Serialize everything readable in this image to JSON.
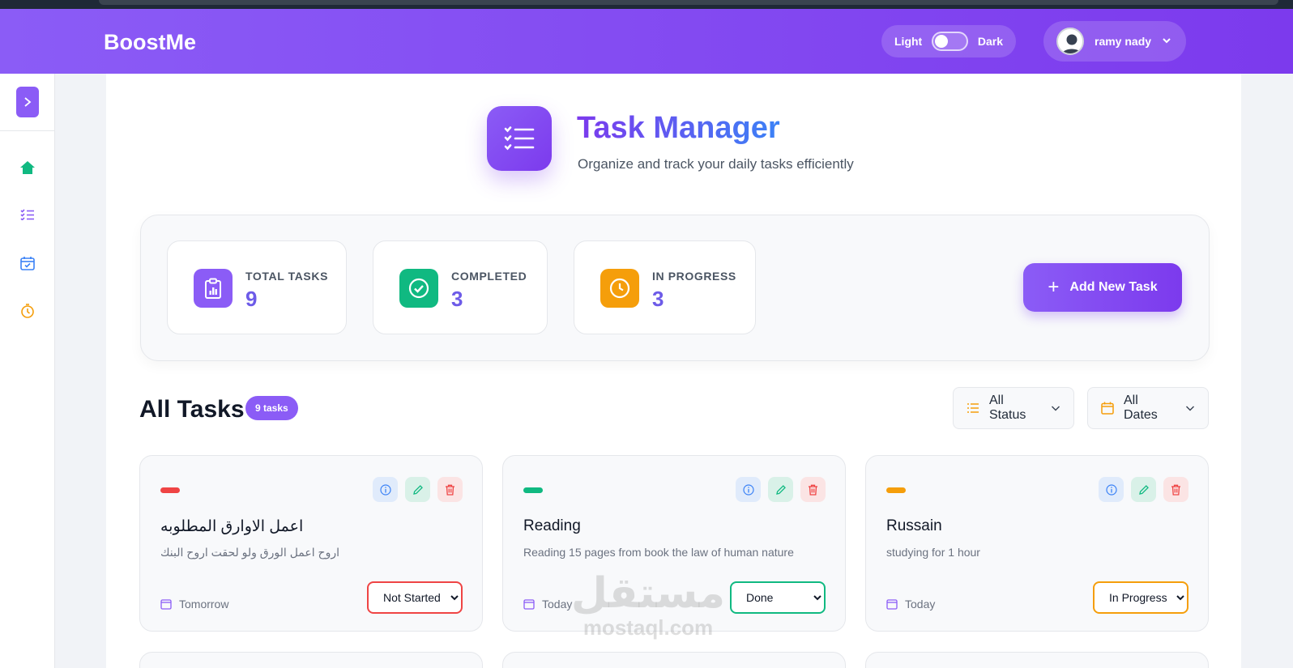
{
  "navbar": {
    "brand": "BoostMe",
    "theme_light_label": "Light",
    "theme_dark_label": "Dark",
    "user_name": "ramy nady"
  },
  "sidebar": {
    "items": [
      {
        "icon": "home-icon",
        "color": "#10b981"
      },
      {
        "icon": "task-list-icon",
        "color": "#8b5cf6"
      },
      {
        "icon": "calendar-check-icon",
        "color": "#3b82f6"
      },
      {
        "icon": "timer-icon",
        "color": "#f59e0b"
      }
    ]
  },
  "header": {
    "title": "Task Manager",
    "subtitle": "Organize and track your daily tasks efficiently"
  },
  "stats": [
    {
      "label": "TOTAL TASKS",
      "value": "9",
      "icon": "clipboard-chart-icon",
      "color": "#8b5cf6"
    },
    {
      "label": "COMPLETED",
      "value": "3",
      "icon": "check-circle-icon",
      "color": "#10b981"
    },
    {
      "label": "IN PROGRESS",
      "value": "3",
      "icon": "clock-icon",
      "color": "#f59e0b"
    }
  ],
  "add_button": {
    "label": "Add New Task"
  },
  "tasks_section": {
    "title": "All Tasks",
    "count_badge": "9 tasks",
    "status_filter": "All Status",
    "date_filter": "All Dates"
  },
  "tasks": [
    {
      "title": "اعمل الاوارق المطلوبه",
      "description": "اروح اعمل الورق ولو لحقت اروح البنك",
      "date": "Tomorrow",
      "status": "Not Started",
      "priority_color": "#ef4444",
      "status_color": "#ef4444"
    },
    {
      "title": "Reading",
      "description": "Reading 15 pages from book the law of human nature",
      "date": "Today",
      "status": "Done",
      "priority_color": "#10b981",
      "status_color": "#10b981"
    },
    {
      "title": "Russain",
      "description": "studying for 1 hour",
      "date": "Today",
      "status": "In Progress",
      "priority_color": "#f59e0b",
      "status_color": "#f59e0b"
    }
  ],
  "watermark": {
    "arabic": "مستقل",
    "latin": "mostaql.com"
  }
}
